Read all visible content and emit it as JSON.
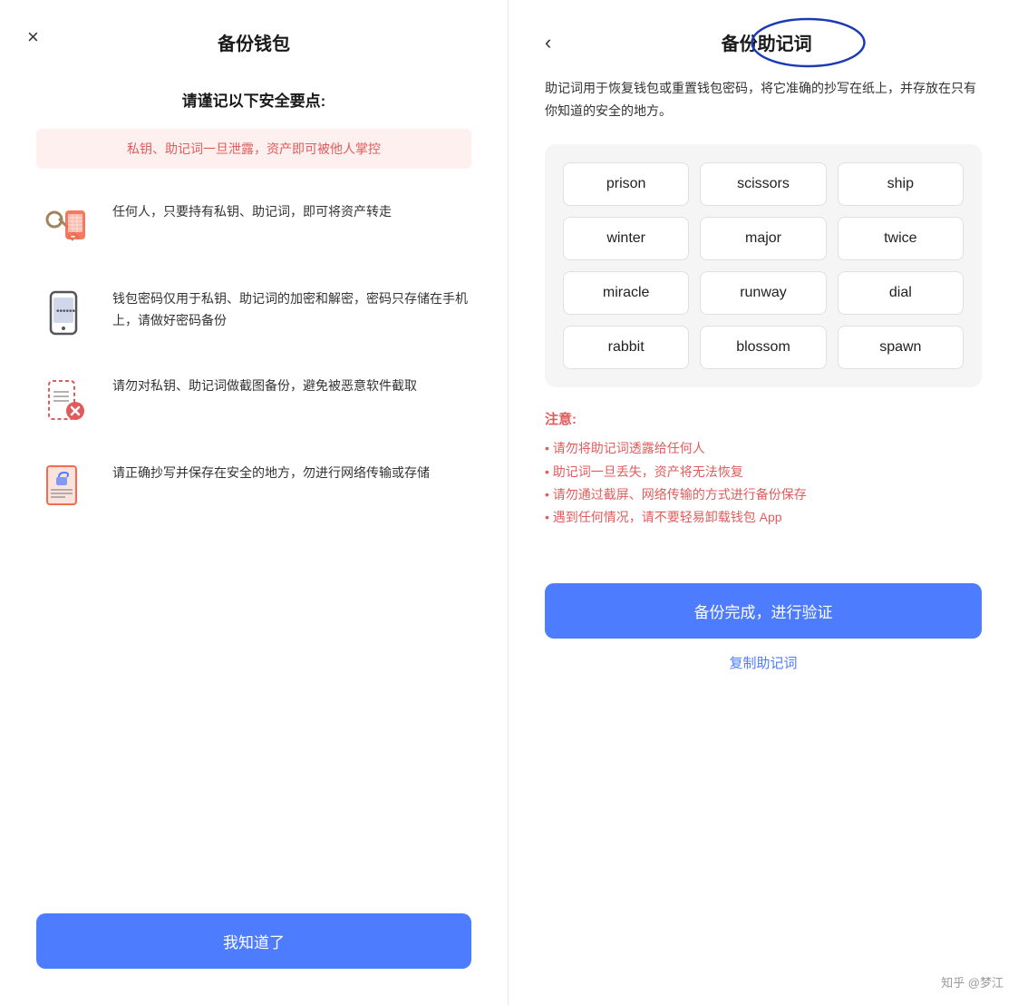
{
  "left": {
    "title": "备份钱包",
    "close_label": "×",
    "subtitle": "请谨记以下安全要点:",
    "warning": "私钥、助记词一旦泄露，资产即可被他人掌控",
    "items": [
      {
        "text": "任何人，只要持有私钥、助记词，即可将资产转走"
      },
      {
        "text": "钱包密码仅用于私钥、助记词的加密和解密，密码只存储在手机上，请做好密码备份"
      },
      {
        "text": "请勿对私钥、助记词做截图备份，避免被恶意软件截取"
      },
      {
        "text": "请正确抄写并保存在安全的地方，勿进行网络传输或存储"
      }
    ],
    "btn_label": "我知道了"
  },
  "right": {
    "title": "备份助记词",
    "back_label": "‹",
    "desc": "助记词用于恢复钱包或重置钱包密码，将它准确的抄写在纸上，并存放在只有你知道的安全的地方。",
    "mnemonic_words": [
      "prison",
      "scissors",
      "ship",
      "winter",
      "major",
      "twice",
      "miracle",
      "runway",
      "dial",
      "rabbit",
      "blossom",
      "spawn"
    ],
    "notes_title": "注意:",
    "notes": [
      "• 请勿将助记词透露给任何人",
      "• 助记词一旦丢失，资产将无法恢复",
      "• 请勿通过截屏、网络传输的方式进行备份保存",
      "• 遇到任何情况，请不要轻易卸载钱包 App"
    ],
    "btn_label": "备份完成，进行验证",
    "copy_label": "复制助记词"
  },
  "watermark": "知乎 @梦江"
}
